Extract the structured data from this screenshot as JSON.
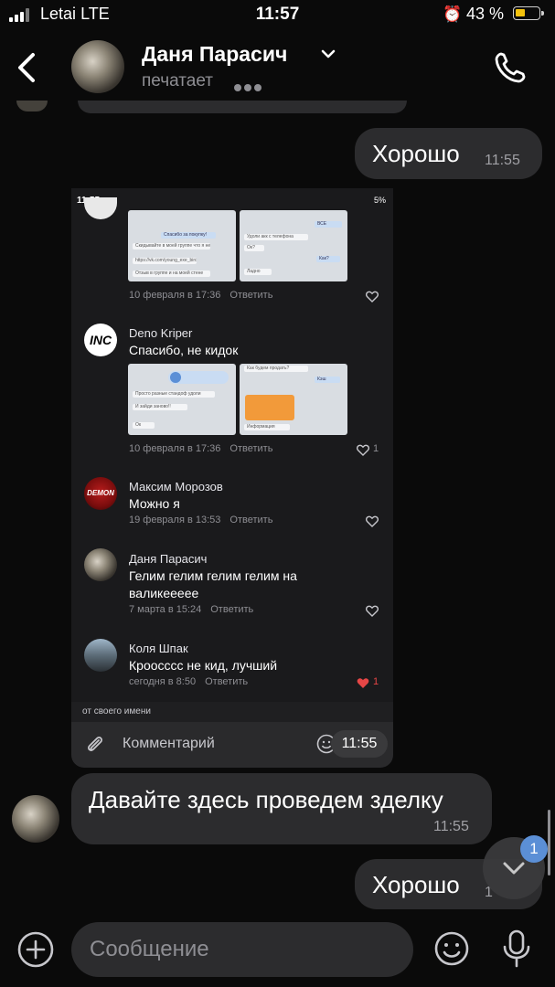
{
  "status_bar": {
    "carrier": "Letai",
    "network": "LTE",
    "time": "11:57",
    "battery_percent": "43 %",
    "battery_level": 0.43
  },
  "header": {
    "name": "Даня Парасич",
    "status": "печатает"
  },
  "messages": [
    {
      "direction": "out",
      "text": "Хорошо",
      "time": "11:55"
    },
    {
      "direction": "in",
      "text": "Давайте здесь проведем зделку",
      "time": "11:55"
    },
    {
      "direction": "out",
      "text": "Хорошо",
      "time": "1"
    }
  ],
  "shared_screenshot": {
    "status_time": "11:55",
    "status_battery": "5%",
    "thumbs": {
      "a1": [
        "Спасибо за покупку!",
        "Скидывайте в моей группе что я не кид",
        "https://vk.com/young_exe_bird",
        "Отзыв в группе и на моей стене"
      ],
      "a2": [
        "ВСЁ",
        "Удоли акк с телефона",
        "Ок?",
        "Как?",
        "Ладно"
      ],
      "b1": [
        "Просто разные стандоф удоли",
        "И зайди заново!!",
        "Ок"
      ],
      "b2": [
        "Как будем продать?",
        "Кэш",
        "Информация"
      ]
    },
    "comments": [
      {
        "author": "",
        "text": "",
        "date": "10 февраля в 17:36",
        "likes": ""
      },
      {
        "author": "Deno Kriper",
        "avatar_text": "INC",
        "text": "Спасибо, не кидок",
        "date": "10 февраля в 17:36",
        "likes": "1"
      },
      {
        "author": "Максим Морозов",
        "avatar_text": "DEMON",
        "text": "Можно я",
        "date": "19 февраля в 13:53",
        "likes": ""
      },
      {
        "author": "Даня Парасич",
        "text": "Гелим гелим гелим гелим на",
        "text2": "валикеееее",
        "date": "7 марта в 15:24",
        "likes": ""
      },
      {
        "author": "Коля Шпак",
        "text": "Кроосссс не кид, лучший",
        "date": "сегодня в 8:50",
        "likes": "1"
      }
    ],
    "reply_label": "Ответить",
    "from_label": "от своего имени",
    "comment_placeholder": "Комментарий",
    "timestamp_pill": "11:55"
  },
  "scroll_down_badge": "1",
  "composer": {
    "placeholder": "Сообщение"
  },
  "colors": {
    "background": "#0a0a0a",
    "bubble": "#2c2c2e",
    "muted": "#8e8e93",
    "badge": "#5b8fd6",
    "like_active": "#e64646",
    "battery": "#f4c20d"
  },
  "icons": [
    "signal-icon",
    "alarm-icon",
    "battery-icon",
    "back-chevron-icon",
    "chevron-down-icon",
    "phone-icon",
    "paperclip-icon",
    "smile-icon",
    "heart-icon",
    "scroll-down-icon",
    "add-icon",
    "sticker-icon",
    "microphone-icon"
  ]
}
